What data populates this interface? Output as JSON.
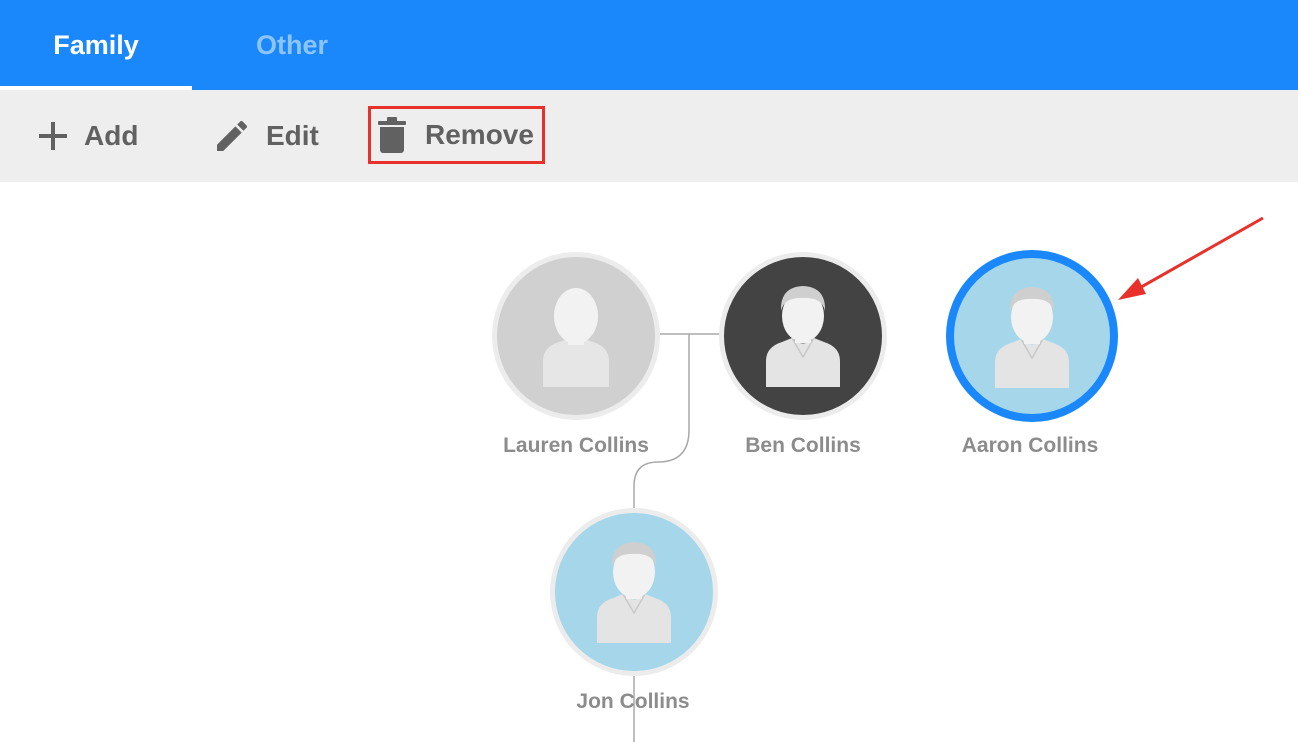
{
  "tabs": {
    "family_label": "Family",
    "other_label": "Other"
  },
  "toolbar": {
    "add_label": "Add",
    "edit_label": "Edit",
    "remove_label": "Remove"
  },
  "people": {
    "lauren": {
      "name": "Lauren Collins",
      "avatar": "female-silhouette-icon",
      "bg": "#d0d0d0"
    },
    "ben": {
      "name": "Ben Collins",
      "avatar": "male-silhouette-icon",
      "bg": "#434343"
    },
    "aaron": {
      "name": "Aaron Collins",
      "avatar": "male-silhouette-icon",
      "bg": "#a5d6ea",
      "selected": true
    },
    "jon": {
      "name": "Jon Collins",
      "avatar": "male-silhouette-icon",
      "bg": "#a5d6ea"
    }
  },
  "colors": {
    "accent": "#1a88fb",
    "highlight": "#e8312b",
    "toolbar_bg": "#eeeeee",
    "label_text": "#8c8c8c"
  }
}
